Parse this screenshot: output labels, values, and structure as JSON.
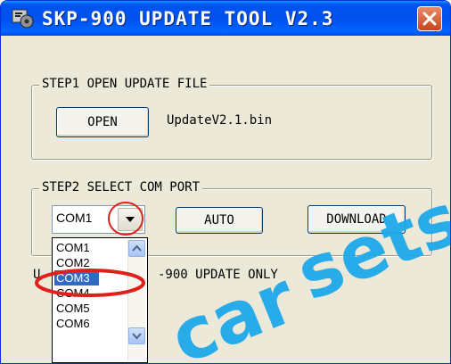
{
  "window": {
    "title": "SKP-900 UPDATE TOOL V2.3",
    "icons": {
      "app": "gear-app-icon",
      "close": "close-icon"
    }
  },
  "step1": {
    "group_label": "STEP1 OPEN UPDATE FILE",
    "open_button": "OPEN",
    "file_name": "UpdateV2.1.bin"
  },
  "step2": {
    "group_label": "STEP2 SELECT COM PORT",
    "com_selected": "COM1",
    "auto_button": "AUTO",
    "download_button": "DOWNLOAD",
    "dropdown_options": [
      "COM1",
      "COM2",
      "COM3",
      "COM4",
      "COM5",
      "COM6"
    ],
    "highlighted_option": "COM3"
  },
  "note": {
    "left_fragment": "U",
    "right_fragment": "-900 UPDATE ONLY"
  },
  "watermark": {
    "text_lower": "car",
    "text_upper": "sets"
  },
  "colors": {
    "titlebar": "#0054e3",
    "selection": "#316ac5",
    "annotation_red": "#e0201a",
    "watermark": "#1ea9ea"
  }
}
